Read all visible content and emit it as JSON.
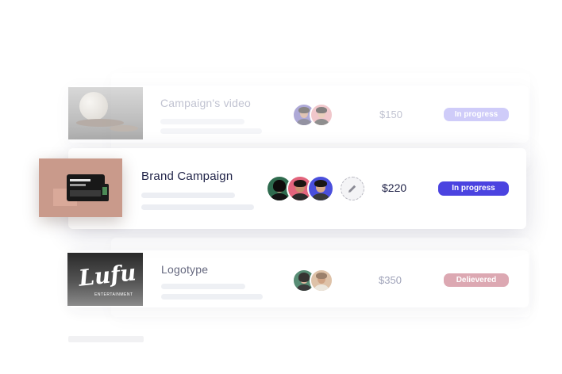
{
  "colors": {
    "accent": "#4b43e0",
    "accent_faded": "#a8a4f5",
    "delivered": "#d79aa5",
    "title_dark": "#1f2247",
    "title_faded": "#8f93ad"
  },
  "projects": [
    {
      "title": "Campaign's video",
      "price": "$150",
      "status": "In progress",
      "team": [
        "avatar-man-glasses",
        "avatar-man-short-hair"
      ]
    },
    {
      "title": "Brand Campaign",
      "price": "$220",
      "status": "In progress",
      "team": [
        "avatar-woman-dark-hair",
        "avatar-man-pink-bg",
        "avatar-woman-blue-bg"
      ],
      "edit_icon": "pencil-icon"
    },
    {
      "title": "Logotype",
      "price": "$350",
      "status": "Delievered",
      "team": [
        "avatar-woman-green-bg",
        "avatar-man-beige-bg"
      ]
    }
  ],
  "logotype_thumb": {
    "brand_text": "Lufu",
    "brand_subtext": "ENTERTAINMENT"
  }
}
